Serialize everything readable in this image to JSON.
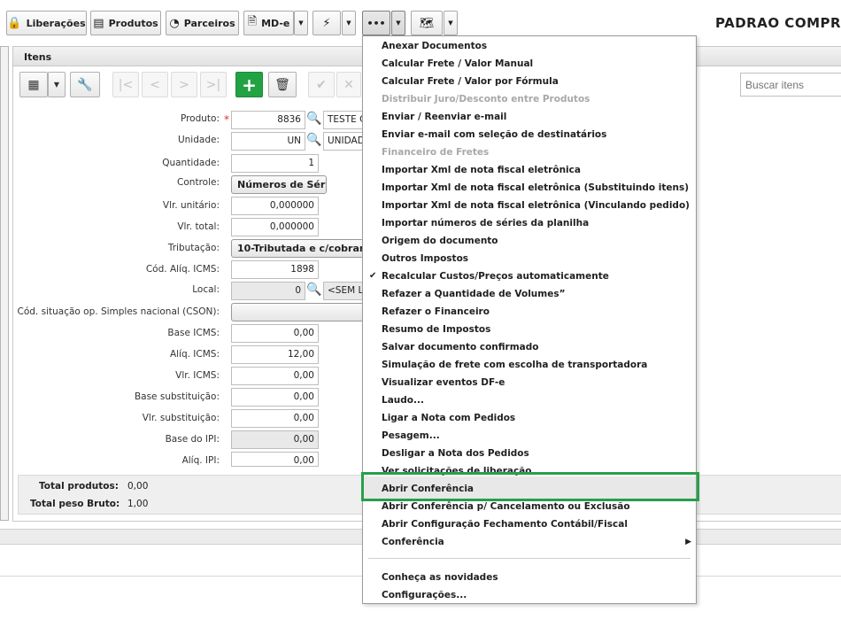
{
  "toolbar": {
    "liberacoes": "Liberações",
    "produtos": "Produtos",
    "parceiros": "Parceiros",
    "mde": "MD-e",
    "more": "•••",
    "title": "PADRAO COMPRA"
  },
  "panel": {
    "title": "Itens"
  },
  "search": {
    "placeholder": "Buscar itens"
  },
  "form": {
    "produto": {
      "label": "Produto:",
      "code": "8836",
      "desc": "TESTE C"
    },
    "unidade": {
      "label": "Unidade:",
      "code": "UN",
      "desc": "UNIDAD"
    },
    "quantidade": {
      "label": "Quantidade:",
      "value": "1"
    },
    "controle": {
      "label": "Controle:",
      "value": "Números de Série"
    },
    "vlr_unitario": {
      "label": "Vlr. unitário:",
      "value": "0,000000"
    },
    "vlr_total": {
      "label": "Vlr. total:",
      "value": "0,000000"
    },
    "tributacao": {
      "label": "Tributação:",
      "value": "10-Tributada e c/cobran"
    },
    "cod_aliq_icms": {
      "label": "Cód. Alíq. ICMS:",
      "value": "1898"
    },
    "local": {
      "label": "Local:",
      "code": "0",
      "desc": "<SEM LO"
    },
    "cson": {
      "label": "Cód. situação op. Simples nacional (CSON):",
      "value": ""
    },
    "base_icms": {
      "label": "Base ICMS:",
      "value": "0,00"
    },
    "aliq_icms": {
      "label": "Alíq. ICMS:",
      "value": "12,00"
    },
    "vlr_icms": {
      "label": "Vlr. ICMS:",
      "value": "0,00"
    },
    "base_subst": {
      "label": "Base substituição:",
      "value": "0,00"
    },
    "vlr_subst": {
      "label": "Vlr. substituição:",
      "value": "0,00"
    },
    "base_ipi": {
      "label": "Base do IPI:",
      "value": "0,00"
    },
    "aliq_ipi": {
      "label": "Alíq. IPI:",
      "value": "0,00"
    }
  },
  "totals": {
    "produtos_label": "Total produtos:",
    "produtos_value": "0,00",
    "peso_label": "Total peso Bruto:",
    "peso_value": "1,00"
  },
  "menu": {
    "items": [
      {
        "label": "Anexar Documentos",
        "enabled": true
      },
      {
        "label": "Calcular Frete / Valor Manual",
        "enabled": true
      },
      {
        "label": "Calcular Frete / Valor por Fórmula",
        "enabled": true
      },
      {
        "label": "Distribuir Juro/Desconto entre Produtos",
        "enabled": false
      },
      {
        "label": "Enviar / Reenviar e-mail",
        "enabled": true
      },
      {
        "label": "Enviar e-mail com seleção de destinatários",
        "enabled": true
      },
      {
        "label": "Financeiro de Fretes",
        "enabled": false
      },
      {
        "label": "Importar Xml de nota fiscal eletrônica",
        "enabled": true
      },
      {
        "label": "Importar Xml de nota fiscal eletrônica (Substituindo itens)",
        "enabled": true
      },
      {
        "label": "Importar Xml de nota fiscal eletrônica (Vinculando pedido)",
        "enabled": true
      },
      {
        "label": "Importar números de séries da planilha",
        "enabled": true
      },
      {
        "label": "Origem do documento",
        "enabled": true
      },
      {
        "label": "Outros Impostos",
        "enabled": true
      },
      {
        "label": "Recalcular Custos/Preços automaticamente",
        "enabled": true,
        "checked": true
      },
      {
        "label": "Refazer a Quantidade de Volumes”",
        "enabled": true
      },
      {
        "label": "Refazer o Financeiro",
        "enabled": true
      },
      {
        "label": "Resumo de Impostos",
        "enabled": true
      },
      {
        "label": "Salvar documento confirmado",
        "enabled": true
      },
      {
        "label": "Simulação de frete com escolha de transportadora",
        "enabled": true
      },
      {
        "label": "Visualizar eventos DF-e",
        "enabled": true
      },
      {
        "label": "Laudo...",
        "enabled": true
      },
      {
        "label": "Ligar a Nota com Pedidos",
        "enabled": true
      },
      {
        "label": "Pesagem...",
        "enabled": true
      },
      {
        "label": "Desligar a Nota dos Pedidos",
        "enabled": true
      },
      {
        "label": "Ver solicitações de liberação",
        "enabled": true
      },
      {
        "label": "Abrir Conferência",
        "enabled": true,
        "highlighted": true
      },
      {
        "label": "Abrir Conferência p/ Cancelamento ou Exclusão",
        "enabled": true
      },
      {
        "label": "Abrir Configuração Fechamento Contábil/Fiscal",
        "enabled": true
      },
      {
        "label": "Conferência",
        "enabled": true,
        "submenu": true
      },
      {
        "label": "Conheça as novidades",
        "enabled": true
      },
      {
        "label": "Configurações...",
        "enabled": true
      }
    ]
  },
  "colors": {
    "accent_green": "#23a243",
    "highlight_box": "#27a04a"
  }
}
